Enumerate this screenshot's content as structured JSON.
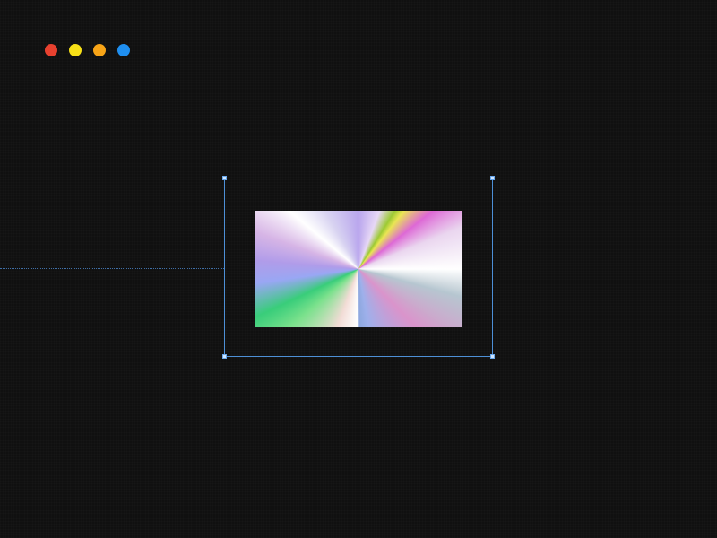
{
  "window_controls": [
    {
      "name": "close",
      "color": "#e8412f"
    },
    {
      "name": "minimize",
      "color": "#f7e017"
    },
    {
      "name": "zoom",
      "color": "#f7a417"
    },
    {
      "name": "extra",
      "color": "#1f8ff0"
    }
  ],
  "colors": {
    "background": "#101010",
    "guide": "#3f6fa8",
    "selection": "#4d8fd6",
    "handle": "#cfe6ff"
  },
  "selection": {
    "handles": [
      "top-left",
      "top-right",
      "bottom-left",
      "bottom-right"
    ]
  },
  "image": {
    "kind": "holographic-gradient"
  }
}
